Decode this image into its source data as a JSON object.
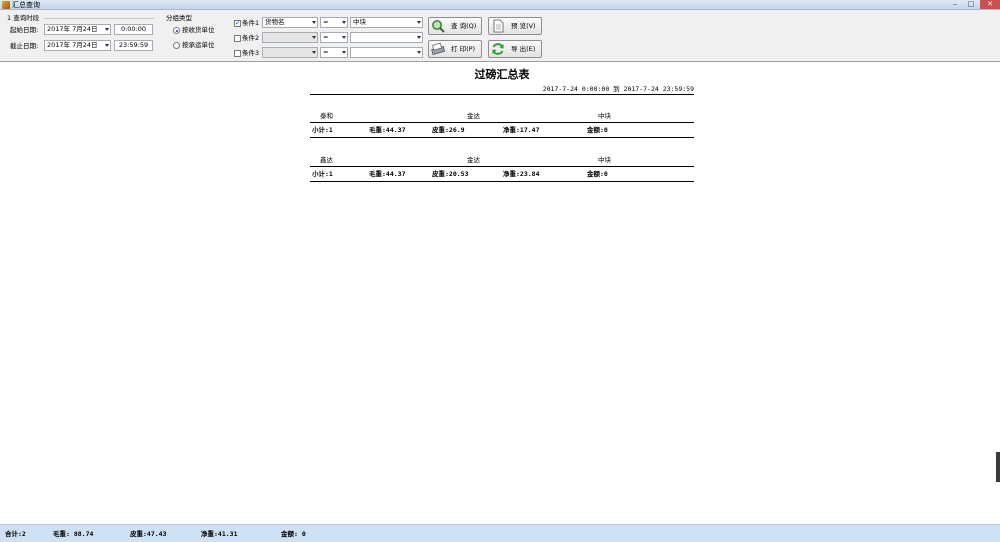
{
  "window": {
    "title": "汇总查询",
    "controls": {
      "minimize": "–",
      "maximize": "□",
      "close": "✕"
    }
  },
  "query_time": {
    "group_label": "1 查询时段",
    "start_label": "起始日期:",
    "start_date": "2017年 7月24日",
    "start_time": "0:00:00",
    "end_label": "截止日期:",
    "end_date": "2017年 7月24日",
    "end_time": "23:59:59"
  },
  "group_type": {
    "label": "分组类型",
    "options": [
      {
        "label": "按收货单位",
        "selected": true
      },
      {
        "label": "按承运单位",
        "selected": false
      }
    ]
  },
  "conditions": [
    {
      "label": "条件1",
      "checked": true,
      "field": "货物名",
      "operator": "=",
      "value": "中块"
    },
    {
      "label": "条件2",
      "checked": false,
      "field": "",
      "operator": "=",
      "value": ""
    },
    {
      "label": "条件3",
      "checked": false,
      "field": "",
      "operator": "=",
      "value": ""
    }
  ],
  "buttons": {
    "query": "查 询(Q)",
    "print": "打 印(P)",
    "preview": "预 览(V)",
    "export": "导 出(E)"
  },
  "icons": {
    "query": "magnifier-icon",
    "print": "printer-icon",
    "preview": "document-icon",
    "export": "refresh-icon"
  },
  "report": {
    "title": "过磅汇总表",
    "range": "2017-7-24 0:00:00 到 2017-7-24 23:59:59",
    "groups": [
      {
        "consignee": "泰和",
        "carrier": "金达",
        "goods": "中块",
        "subtotal": "小计:1",
        "gross": "毛重:44.37",
        "tare": "皮重:26.9",
        "net": "净重:17.47",
        "amount": "金额:0"
      },
      {
        "consignee": "鑫达",
        "carrier": "金达",
        "goods": "中块",
        "subtotal": "小计:1",
        "gross": "毛重:44.37",
        "tare": "皮重:20.53",
        "net": "净重:23.84",
        "amount": "金额:0"
      }
    ]
  },
  "totals": {
    "count": "合计:2",
    "gross": "毛重: 88.74",
    "tare": "皮重:47.43",
    "net": "净重:41.31",
    "amount": "金额: 0"
  }
}
